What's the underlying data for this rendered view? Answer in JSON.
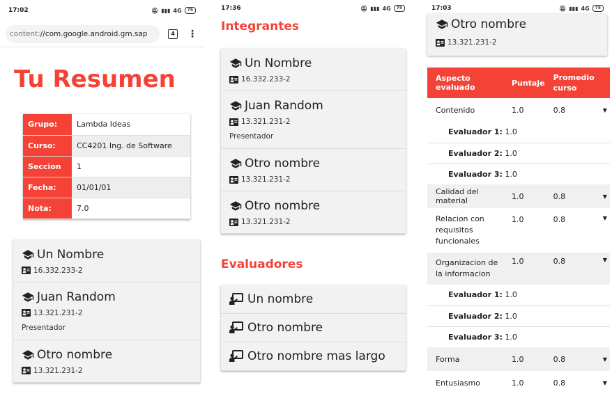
{
  "panel1": {
    "status": {
      "time": "17:02",
      "network": "4G",
      "battery": "75"
    },
    "browser": {
      "url_scheme": "content:",
      "url_rest": "//com.google.android.gm.sap",
      "tab_count": "4",
      "menu": "⋮"
    },
    "title": "Tu Resumen",
    "info": [
      {
        "key": "Grupo:",
        "value": "Lambda Ideas"
      },
      {
        "key": "Curso:",
        "value": "CC4201 Ing. de Software"
      },
      {
        "key": "Seccion",
        "value": "1"
      },
      {
        "key": "Fecha:",
        "value": "01/01/01"
      },
      {
        "key": "Nota:",
        "value": "7.0"
      }
    ],
    "members": [
      {
        "name": "Un Nombre",
        "id": "16.332.233-2",
        "role": ""
      },
      {
        "name": "Juan Random",
        "id": "13.321.231-2",
        "role": "Presentador"
      },
      {
        "name": "Otro nombre",
        "id": "13.321.231-2",
        "role": ""
      }
    ]
  },
  "panel2": {
    "status": {
      "time": "17:36",
      "network": "4G",
      "battery": "75"
    },
    "integrantes_title": "Integrantes",
    "members": [
      {
        "name": "Un Nombre",
        "id": "16.332.233-2",
        "role": ""
      },
      {
        "name": "Juan Random",
        "id": "13.321.231-2",
        "role": "Presentador"
      },
      {
        "name": "Otro nombre",
        "id": "13.321.231-2",
        "role": ""
      },
      {
        "name": "Otro nombre",
        "id": "13.321.231-2",
        "role": ""
      }
    ],
    "evaluadores_title": "Evaluadores",
    "evaluators": [
      "Un nombre",
      "Otro nombre",
      "Otro nombre mas largo"
    ]
  },
  "panel3": {
    "status": {
      "time": "17:03",
      "network": "4G",
      "battery": "75"
    },
    "top_member": {
      "name": "Otro nombre",
      "id": "13.321.231-2"
    },
    "headers": {
      "aspect": "Aspecto evaluado",
      "score": "Puntaje",
      "avg": "Promedio curso"
    },
    "rows": [
      {
        "aspect": "Contenido",
        "score": "1.0",
        "avg": "0.8"
      },
      {
        "aspect": "Calidad del material",
        "score": "1.0",
        "avg": "0.8"
      },
      {
        "aspect": "Relacion con requisitos funcionales",
        "score": "1.0",
        "avg": "0.8"
      },
      {
        "aspect": "Organizacion de la informacion",
        "score": "1.0",
        "avg": "0.8"
      },
      {
        "aspect": "Forma",
        "score": "1.0",
        "avg": "0.8"
      },
      {
        "aspect": "Entusiasmo",
        "score": "1.0",
        "avg": "0.8"
      }
    ],
    "evaluator_scores": [
      {
        "label": "Evaluador 1:",
        "score": "1.0"
      },
      {
        "label": "Evaluador 2:",
        "score": "1.0"
      },
      {
        "label": "Evaluador 3:",
        "score": "1.0"
      }
    ]
  }
}
